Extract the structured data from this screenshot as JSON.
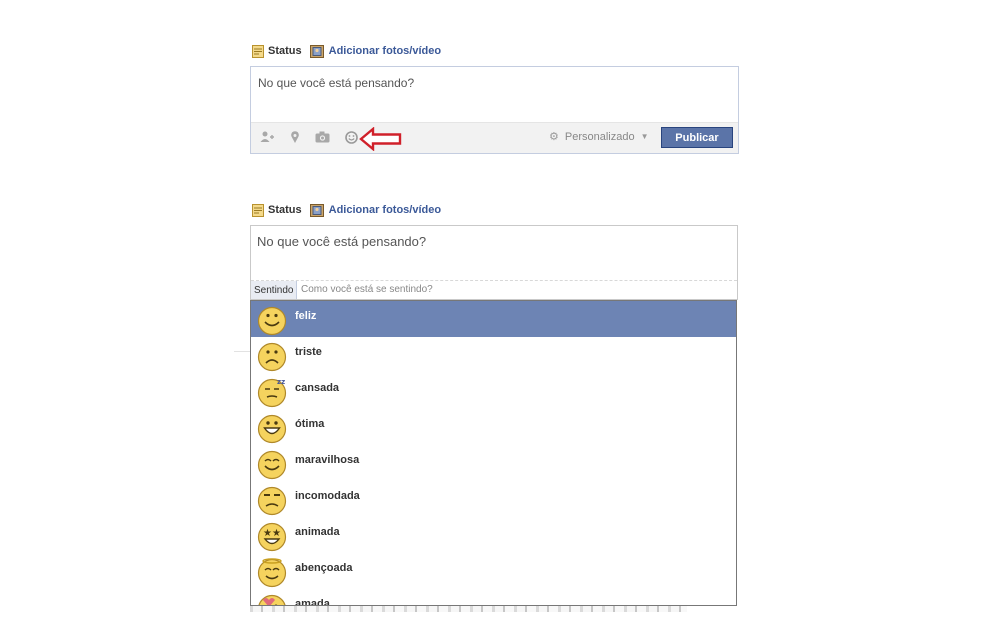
{
  "composer_top": {
    "tabs": {
      "status_label": "Status",
      "photo_label": "Adicionar fotos/vídeo"
    },
    "placeholder": "No que você está pensando?",
    "toolbar_icons": [
      "tag-friends-icon",
      "location-pin-icon",
      "camera-icon",
      "smiley-icon"
    ],
    "privacy_label": "Personalizado",
    "publish_label": "Publicar",
    "annotation": "red-arrow-pointing-at-smiley"
  },
  "composer_bottom": {
    "tabs": {
      "status_label": "Status",
      "photo_label": "Adicionar fotos/vídeo"
    },
    "placeholder": "No que você está pensando?",
    "feeling_tag": "Sentindo",
    "feeling_placeholder": "Como você está se sentindo?"
  },
  "feelings": [
    {
      "label": "feliz",
      "icon": "happy-face-icon",
      "selected": true
    },
    {
      "label": "triste",
      "icon": "sad-face-icon",
      "selected": false
    },
    {
      "label": "cansada",
      "icon": "tired-face-icon",
      "selected": false
    },
    {
      "label": "ótima",
      "icon": "great-face-icon",
      "selected": false
    },
    {
      "label": "maravilhosa",
      "icon": "wonderful-face-icon",
      "selected": false
    },
    {
      "label": "incomodada",
      "icon": "annoyed-face-icon",
      "selected": false
    },
    {
      "label": "animada",
      "icon": "excited-face-icon",
      "selected": false
    },
    {
      "label": "abençoada",
      "icon": "blessed-face-icon",
      "selected": false
    },
    {
      "label": "amada",
      "icon": "loved-face-icon",
      "selected": false
    }
  ],
  "colors": {
    "brand_blue": "#3b5998",
    "publish_button": "#5b74a8",
    "selected_row": "#6d84b4",
    "arrow_red": "#d0202a",
    "emoji_yellow": "#f5d35e"
  }
}
